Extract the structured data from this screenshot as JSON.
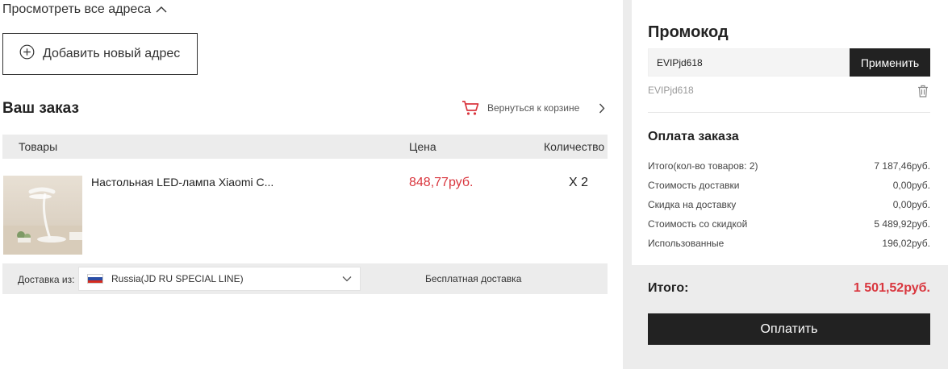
{
  "address": {
    "view_all_label": "Просмотреть все адреса",
    "add_new_label": "Добавить новый адрес"
  },
  "order": {
    "title": "Ваш заказ",
    "back_to_cart_label": "Вернуться к корзине",
    "columns": {
      "goods": "Товары",
      "price": "Цена",
      "quantity": "Количество"
    },
    "item": {
      "name": "Настольная LED-лампа Xiaomi C...",
      "price": "848,77руб.",
      "quantity": "X 2"
    },
    "shipping": {
      "from_label": "Доставка из:",
      "selected_option": "Russia(JD RU SPECIAL LINE)",
      "free_label": "Бесплатная доставка"
    }
  },
  "promo": {
    "title": "Промокод",
    "input_value": "EVIPjd618",
    "apply_label": "Применить",
    "applied_code": "EVIPjd618"
  },
  "payment": {
    "title": "Оплата заказа",
    "rows": [
      {
        "label": "Итого(кол-во товаров: 2)",
        "value": "7 187,46руб."
      },
      {
        "label": "Стоимость доставки",
        "value": "0,00руб."
      },
      {
        "label": "Скидка на доставку",
        "value": "0,00руб."
      },
      {
        "label": "Стоимость со скидкой",
        "value": "5 489,92руб."
      },
      {
        "label": "Использованные",
        "value": "196,02руб."
      }
    ],
    "total_label": "Итого:",
    "total_value": "1 501,52руб.",
    "pay_label": "Оплатить"
  },
  "colors": {
    "accent_red": "#d9363e",
    "dark": "#222222",
    "panel_gray": "#ececec"
  },
  "icons": {
    "view_all": "chevron-up-icon",
    "add": "plus-circle-icon",
    "cart": "cart-icon",
    "back": "chevron-right-icon",
    "select": "chevron-down-icon",
    "delete": "trash-icon",
    "flag": "russia-flag-icon"
  }
}
